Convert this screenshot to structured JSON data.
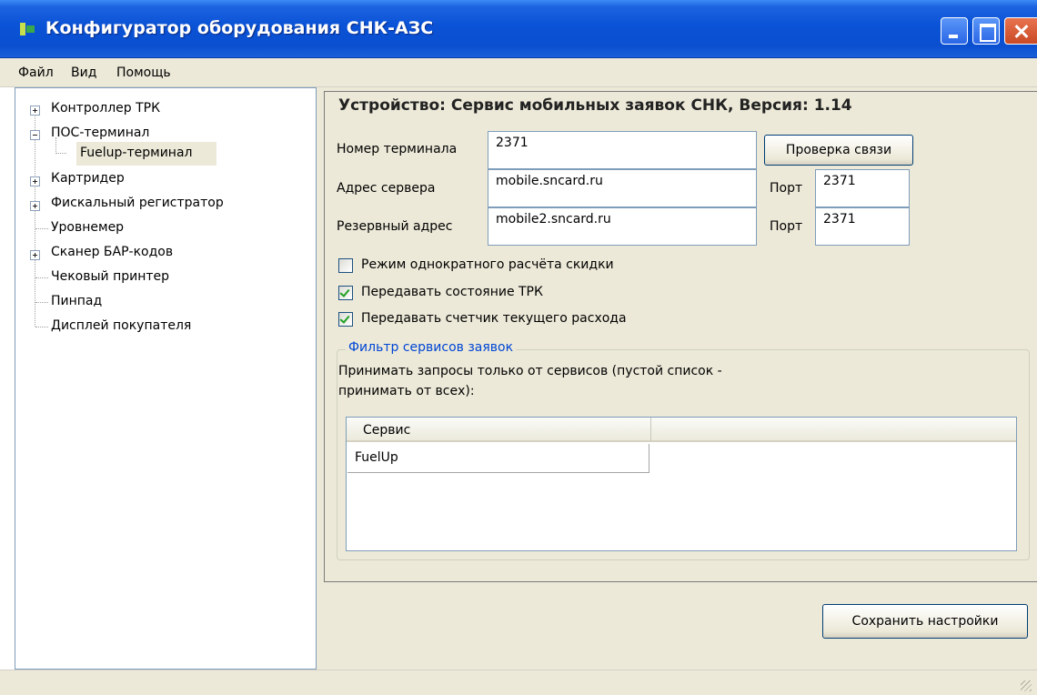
{
  "window": {
    "title": "Конфигуратор оборудования СНК-АЗС"
  },
  "menu": {
    "items": [
      "Файл",
      "Вид",
      "Помощь"
    ]
  },
  "tree": {
    "items": [
      {
        "label": "Контроллер ТРК",
        "expander": "+"
      },
      {
        "label": "ПОС-терминал",
        "expander": "-"
      },
      {
        "label": "Fuelup-терминал",
        "expander": ""
      },
      {
        "label": "Картридер",
        "expander": "+"
      },
      {
        "label": "Фискальный регистратор",
        "expander": "+"
      },
      {
        "label": "Уровнемер",
        "expander": ""
      },
      {
        "label": "Сканер БАР-кодов",
        "expander": "+"
      },
      {
        "label": "Чековый принтер",
        "expander": ""
      },
      {
        "label": "Пинпад",
        "expander": ""
      },
      {
        "label": "Дисплей покупателя",
        "expander": ""
      }
    ],
    "selected": "Fuelup-терминал"
  },
  "device": {
    "title": "Устройство: Сервис мобильных заявок СНК, Версия: 1.14",
    "terminal_label": "Номер терминала",
    "terminal_value": "2371",
    "check_button": "Проверка связи",
    "server_label": "Адрес сервера",
    "server_value": "mobile.sncard.ru",
    "port_label": "Порт",
    "server_port": "2371",
    "backup_label": "Резервный адрес",
    "backup_value": "mobile2.sncard.ru",
    "backup_port": "2371"
  },
  "options": [
    {
      "label": "Режим однократного расчёта скидки",
      "checked": false
    },
    {
      "label": "Передавать состояние ТРК",
      "checked": true
    },
    {
      "label": "Передавать счетчик текущего расхода",
      "checked": true
    }
  ],
  "filter": {
    "title": "Фильтр сервисов заявок",
    "description_line1": "Принимать запросы только от сервисов (пустой список -",
    "description_line2": "принимать от всех):",
    "column": "Сервис",
    "rows": [
      "FuelUp"
    ]
  },
  "save_button": "Сохранить настройки"
}
